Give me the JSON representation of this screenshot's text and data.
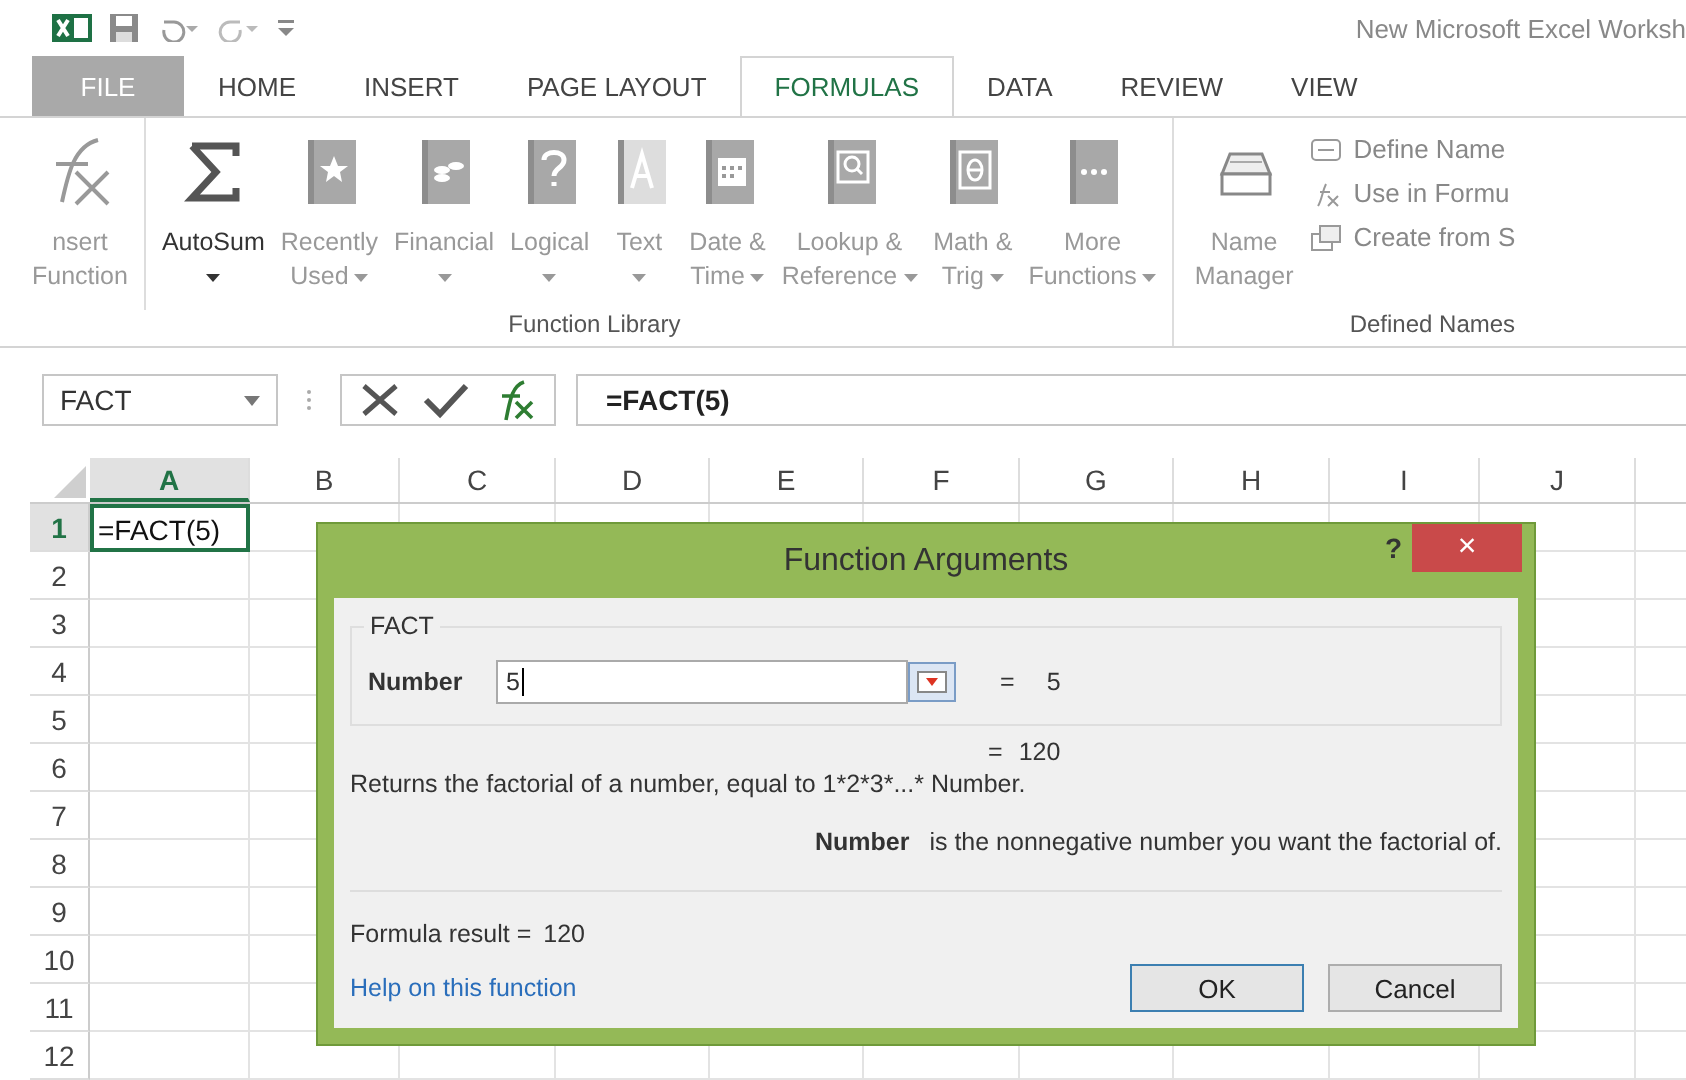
{
  "window": {
    "title": "New Microsoft Excel Worksh"
  },
  "tabs": [
    {
      "label": "FILE",
      "selected": false,
      "kind": "file"
    },
    {
      "label": "HOME",
      "selected": false,
      "kind": "tab"
    },
    {
      "label": "INSERT",
      "selected": false,
      "kind": "tab"
    },
    {
      "label": "PAGE LAYOUT",
      "selected": false,
      "kind": "tab"
    },
    {
      "label": "FORMULAS",
      "selected": true,
      "kind": "tab"
    },
    {
      "label": "DATA",
      "selected": false,
      "kind": "tab"
    },
    {
      "label": "REVIEW",
      "selected": false,
      "kind": "tab"
    },
    {
      "label": "VIEW",
      "selected": false,
      "kind": "tab"
    }
  ],
  "function_library": {
    "label": "Function Library",
    "buttons": [
      {
        "lines": [
          "nsert",
          "Function"
        ],
        "disabled": true,
        "menu": false
      },
      {
        "lines": [
          "AutoSum"
        ],
        "disabled": false,
        "menu": true
      },
      {
        "lines": [
          "Recently",
          "Used"
        ],
        "disabled": true,
        "menu": true
      },
      {
        "lines": [
          "Financial"
        ],
        "disabled": true,
        "menu": true
      },
      {
        "lines": [
          "Logical"
        ],
        "disabled": true,
        "menu": true
      },
      {
        "lines": [
          "Text"
        ],
        "disabled": true,
        "menu": true
      },
      {
        "lines": [
          "Date &",
          "Time"
        ],
        "disabled": true,
        "menu": true
      },
      {
        "lines": [
          "Lookup &",
          "Reference"
        ],
        "disabled": true,
        "menu": true
      },
      {
        "lines": [
          "Math &",
          "Trig"
        ],
        "disabled": true,
        "menu": true
      },
      {
        "lines": [
          "More",
          "Functions"
        ],
        "disabled": true,
        "menu": true
      }
    ]
  },
  "defined_names": {
    "label": "Defined Names",
    "manager": [
      "Name",
      "Manager"
    ],
    "items": [
      "Define Name",
      "Use in Formu",
      "Create from S"
    ]
  },
  "formula_bar": {
    "name_box": "FACT",
    "formula": "=FACT(5)"
  },
  "columns": [
    {
      "label": "A",
      "selected": true
    },
    {
      "label": "B",
      "selected": false
    },
    {
      "label": "C",
      "selected": false
    },
    {
      "label": "D",
      "selected": false
    },
    {
      "label": "E",
      "selected": false
    },
    {
      "label": "F",
      "selected": false
    },
    {
      "label": "G",
      "selected": false
    },
    {
      "label": "H",
      "selected": false
    },
    {
      "label": "I",
      "selected": false
    },
    {
      "label": "J",
      "selected": false
    }
  ],
  "rows": [
    {
      "label": "1",
      "selected": true,
      "cell_a": "=FACT(5)"
    },
    {
      "label": "2",
      "selected": false
    },
    {
      "label": "3",
      "selected": false
    },
    {
      "label": "4",
      "selected": false
    },
    {
      "label": "5",
      "selected": false
    },
    {
      "label": "6",
      "selected": false
    },
    {
      "label": "7",
      "selected": false
    },
    {
      "label": "8",
      "selected": false
    },
    {
      "label": "9",
      "selected": false
    },
    {
      "label": "10",
      "selected": false
    },
    {
      "label": "11",
      "selected": false
    },
    {
      "label": "12",
      "selected": false
    }
  ],
  "dialog": {
    "title": "Function Arguments",
    "help": "?",
    "close": "×",
    "function": "FACT",
    "argument": {
      "label": "Number",
      "value": "5",
      "equals": "=",
      "result": "5"
    },
    "result_equals": "=",
    "result": "120",
    "description": "Returns the factorial of a number, equal to 1*2*3*...* Number.",
    "argument_help": {
      "name": "Number",
      "text": "is the nonnegative number you want the factorial of."
    },
    "formula_result_label": "Formula result =",
    "formula_result": "120",
    "help_link": "Help on this function",
    "buttons": [
      {
        "label": "OK",
        "default": true
      },
      {
        "label": "Cancel",
        "default": false
      }
    ]
  }
}
